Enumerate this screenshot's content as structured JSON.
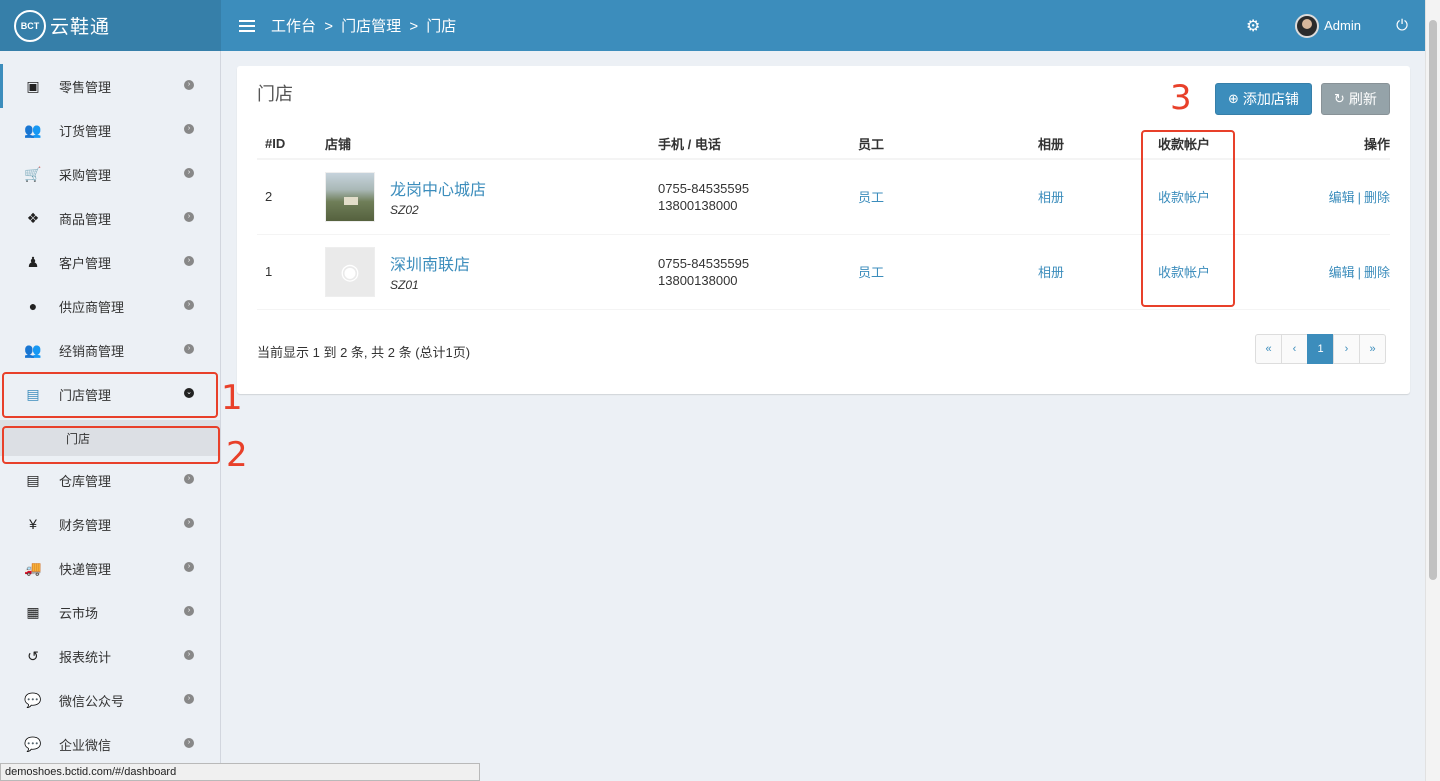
{
  "header": {
    "logo_badge": "BCT",
    "logo_text": "云鞋通",
    "breadcrumb": [
      "工作台",
      "门店管理",
      "门店"
    ],
    "breadcrumb_sep": ">",
    "user_name": "Admin"
  },
  "sidebar": {
    "items": [
      {
        "label": "零售管理",
        "icon": "money-icon"
      },
      {
        "label": "订货管理",
        "icon": "users-icon"
      },
      {
        "label": "采购管理",
        "icon": "cart-icon"
      },
      {
        "label": "商品管理",
        "icon": "cubes-icon"
      },
      {
        "label": "客户管理",
        "icon": "person-icon"
      },
      {
        "label": "供应商管理",
        "icon": "user-icon"
      },
      {
        "label": "经销商管理",
        "icon": "users-icon"
      },
      {
        "label": "门店管理",
        "icon": "archive-icon"
      },
      {
        "label": "仓库管理",
        "icon": "archive-icon"
      },
      {
        "label": "财务管理",
        "icon": "yen-icon"
      },
      {
        "label": "快递管理",
        "icon": "truck-icon"
      },
      {
        "label": "云市场",
        "icon": "building-icon"
      },
      {
        "label": "报表统计",
        "icon": "history-icon"
      },
      {
        "label": "微信公众号",
        "icon": "wechat-icon"
      },
      {
        "label": "企业微信",
        "icon": "wechat-icon"
      }
    ],
    "sub_item": "门店"
  },
  "annotations": {
    "n1": "1",
    "n2": "2",
    "n3": "3"
  },
  "box": {
    "title": "门店",
    "add_button": "添加店铺",
    "refresh_button": "刷新"
  },
  "table": {
    "columns": [
      "#ID",
      "店铺",
      "手机 / 电话",
      "员工",
      "相册",
      "收款帐户",
      "操作"
    ],
    "rows": [
      {
        "id": "2",
        "name": "龙岗中心城店",
        "code": "SZ02",
        "phone": "0755-84535595",
        "mobile": "13800138000",
        "staff": "员工",
        "album": "相册",
        "account": "收款帐户",
        "edit": "编辑",
        "sep": "|",
        "delete": "删除"
      },
      {
        "id": "1",
        "name": "深圳南联店",
        "code": "SZ01",
        "phone": "0755-84535595",
        "mobile": "13800138000",
        "staff": "员工",
        "album": "相册",
        "account": "收款帐户",
        "edit": "编辑",
        "sep": "|",
        "delete": "删除"
      }
    ]
  },
  "footer": {
    "info": "当前显示 1 到 2 条, 共 2 条 (总计1页)",
    "pager": [
      "«",
      "‹",
      "1",
      "›",
      "»"
    ]
  },
  "statusbar": "demoshoes.bctid.com/#/dashboard",
  "colors": {
    "primary": "#3c8dbc",
    "annotation": "#e8402a"
  }
}
